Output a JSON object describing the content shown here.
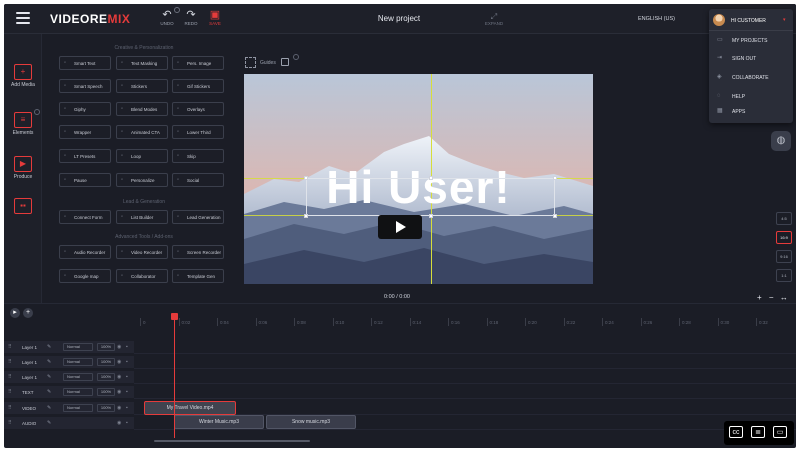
{
  "app": {
    "logo_main": "VIDEORE",
    "logo_accent": "MIX",
    "project_title": "New project"
  },
  "toolbar": {
    "undo": "UNDO",
    "redo": "REDO",
    "save": "SAVE",
    "expand": "EXPAND",
    "language": "ENGLISH (US)"
  },
  "user": {
    "name": "HI CUSTOMER",
    "menu": [
      {
        "label": "MY PROJECTS",
        "icon": "folder-icon"
      },
      {
        "label": "SIGN OUT",
        "icon": "sign-out-icon"
      },
      {
        "label": "COLLABORATE",
        "icon": "collaborate-icon"
      },
      {
        "label": "HELP",
        "icon": "help-icon"
      },
      {
        "label": "APPS",
        "icon": "apps-icon"
      }
    ]
  },
  "rail": [
    {
      "label": "Add Media",
      "icon": "add-media-icon"
    },
    {
      "label": "Elements",
      "icon": "elements-icon"
    },
    {
      "label": "Produce",
      "icon": "produce-icon"
    },
    {
      "label": "",
      "icon": "layout-icon"
    }
  ],
  "panel": {
    "sections": [
      {
        "title": "Creative & Personalization"
      },
      {
        "title": "Lead & Generation"
      },
      {
        "title": "Advanced Tools / Add-ons"
      }
    ],
    "tools_creative": [
      "Smart Text",
      "Text Masking",
      "Pers. Image",
      "Smart Speech",
      "Stickers",
      "Gif Stickers",
      "Giphy",
      "Blend Modes",
      "Overlays",
      "Wrapper",
      "Animated CTA",
      "Lower Third",
      "LT Presets",
      "Loop",
      "Skip",
      "Pause",
      "Personalize",
      "Social"
    ],
    "tools_lead": [
      "Connect Form",
      "List Builder",
      "Lead Generation"
    ],
    "tools_advanced": [
      "Audio Recorder",
      "Video Recorder",
      "Screen Recorder",
      "Google map",
      "Collaborator",
      "Template Gen"
    ]
  },
  "guides": {
    "label": "Guides"
  },
  "canvas": {
    "text": "Hi User!"
  },
  "player": {
    "time": "0:00 / 0:00",
    "zoom_in": "+",
    "zoom_out": "−",
    "fit": "↔"
  },
  "aspect_ratios": [
    {
      "label": "4:5",
      "active": false
    },
    {
      "label": "16:9",
      "active": true
    },
    {
      "label": "9:16",
      "active": false
    },
    {
      "label": "1:1",
      "active": false
    }
  ],
  "timeline": {
    "ticks": [
      "0",
      "0:02",
      "0:04",
      "0:06",
      "0:08",
      "0:10",
      "0:12",
      "0:14",
      "0:16",
      "0:18",
      "0:20",
      "0:22",
      "0:24",
      "0:26",
      "0:28",
      "0:30",
      "0:32"
    ],
    "layers": [
      {
        "name": "Layer 1",
        "blend": "Normal",
        "opacity": "100%"
      },
      {
        "name": "Layer 1",
        "blend": "Normal",
        "opacity": "100%"
      },
      {
        "name": "Layer 1",
        "blend": "Normal",
        "opacity": "100%"
      },
      {
        "name": "TEXT",
        "blend": "Normal",
        "opacity": "100%"
      },
      {
        "name": "VIDEO",
        "blend": "Normal",
        "opacity": "100%"
      },
      {
        "name": "AUDIO",
        "blend": "",
        "opacity": ""
      }
    ],
    "clips": {
      "video": "My Travel Video.mp4",
      "audio1": "Winter Music.mp3",
      "audio2": "Snow music.mp3"
    }
  },
  "colors": {
    "accent": "#e53b3b",
    "bg": "#1b1d26",
    "guide": "#d6de3a"
  }
}
